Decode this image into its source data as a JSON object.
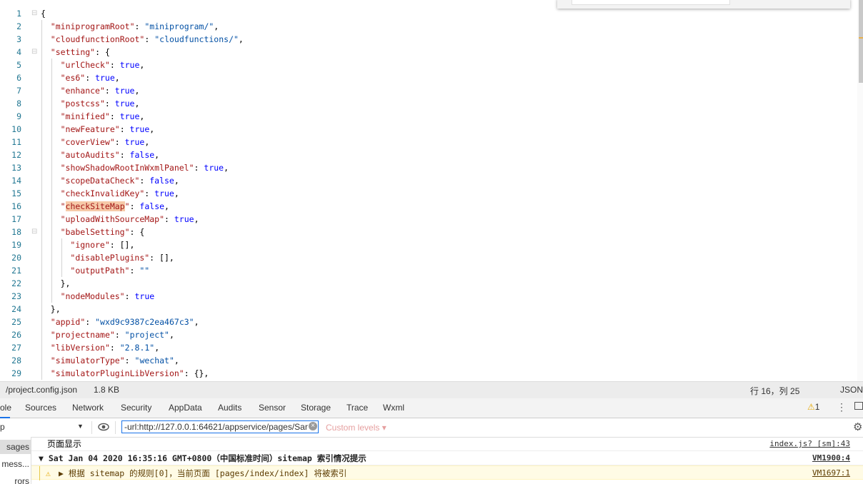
{
  "editor": {
    "lines": [
      [
        [
          "p",
          "{"
        ]
      ],
      [
        [
          "k",
          "\"miniprogramRoot\""
        ],
        [
          "p",
          ": "
        ],
        [
          "s",
          "\"miniprogram/\""
        ],
        [
          "p",
          ","
        ]
      ],
      [
        [
          "k",
          "\"cloudfunctionRoot\""
        ],
        [
          "p",
          ": "
        ],
        [
          "s",
          "\"cloudfunctions/\""
        ],
        [
          "p",
          ","
        ]
      ],
      [
        [
          "k",
          "\"setting\""
        ],
        [
          "p",
          ": {"
        ]
      ],
      [
        [
          "k",
          "\"urlCheck\""
        ],
        [
          "p",
          ": "
        ],
        [
          "b",
          "true"
        ],
        [
          "p",
          ","
        ]
      ],
      [
        [
          "k",
          "\"es6\""
        ],
        [
          "p",
          ": "
        ],
        [
          "b",
          "true"
        ],
        [
          "p",
          ","
        ]
      ],
      [
        [
          "k",
          "\"enhance\""
        ],
        [
          "p",
          ": "
        ],
        [
          "b",
          "true"
        ],
        [
          "p",
          ","
        ]
      ],
      [
        [
          "k",
          "\"postcss\""
        ],
        [
          "p",
          ": "
        ],
        [
          "b",
          "true"
        ],
        [
          "p",
          ","
        ]
      ],
      [
        [
          "k",
          "\"minified\""
        ],
        [
          "p",
          ": "
        ],
        [
          "b",
          "true"
        ],
        [
          "p",
          ","
        ]
      ],
      [
        [
          "k",
          "\"newFeature\""
        ],
        [
          "p",
          ": "
        ],
        [
          "b",
          "true"
        ],
        [
          "p",
          ","
        ]
      ],
      [
        [
          "k",
          "\"coverView\""
        ],
        [
          "p",
          ": "
        ],
        [
          "b",
          "true"
        ],
        [
          "p",
          ","
        ]
      ],
      [
        [
          "k",
          "\"autoAudits\""
        ],
        [
          "p",
          ": "
        ],
        [
          "b",
          "false"
        ],
        [
          "p",
          ","
        ]
      ],
      [
        [
          "k",
          "\"showShadowRootInWxmlPanel\""
        ],
        [
          "p",
          ": "
        ],
        [
          "b",
          "true"
        ],
        [
          "p",
          ","
        ]
      ],
      [
        [
          "k",
          "\"scopeDataCheck\""
        ],
        [
          "p",
          ": "
        ],
        [
          "b",
          "false"
        ],
        [
          "p",
          ","
        ]
      ],
      [
        [
          "k",
          "\"checkInvalidKey\""
        ],
        [
          "p",
          ": "
        ],
        [
          "b",
          "true"
        ],
        [
          "p",
          ","
        ]
      ],
      [
        [
          "k",
          "\""
        ],
        [
          "h",
          "checkSiteMap"
        ],
        [
          "k",
          "\""
        ],
        [
          "p",
          ": "
        ],
        [
          "b",
          "false"
        ],
        [
          "p",
          ","
        ]
      ],
      [
        [
          "k",
          "\"uploadWithSourceMap\""
        ],
        [
          "p",
          ": "
        ],
        [
          "b",
          "true"
        ],
        [
          "p",
          ","
        ]
      ],
      [
        [
          "k",
          "\"babelSetting\""
        ],
        [
          "p",
          ": {"
        ]
      ],
      [
        [
          "k",
          "\"ignore\""
        ],
        [
          "p",
          ": [],"
        ]
      ],
      [
        [
          "k",
          "\"disablePlugins\""
        ],
        [
          "p",
          ": [],"
        ]
      ],
      [
        [
          "k",
          "\"outputPath\""
        ],
        [
          "p",
          ": "
        ],
        [
          "s",
          "\"\""
        ]
      ],
      [
        [
          "p",
          "},"
        ]
      ],
      [
        [
          "k",
          "\"nodeModules\""
        ],
        [
          "p",
          ": "
        ],
        [
          "b",
          "true"
        ]
      ],
      [
        [
          "p",
          "},"
        ]
      ],
      [
        [
          "k",
          "\"appid\""
        ],
        [
          "p",
          ": "
        ],
        [
          "s",
          "\"wxd9c9387c2ea467c3\""
        ],
        [
          "p",
          ","
        ]
      ],
      [
        [
          "k",
          "\"projectname\""
        ],
        [
          "p",
          ": "
        ],
        [
          "s",
          "\"project\""
        ],
        [
          "p",
          ","
        ]
      ],
      [
        [
          "k",
          "\"libVersion\""
        ],
        [
          "p",
          ": "
        ],
        [
          "s",
          "\"2.8.1\""
        ],
        [
          "p",
          ","
        ]
      ],
      [
        [
          "k",
          "\"simulatorType\""
        ],
        [
          "p",
          ": "
        ],
        [
          "s",
          "\"wechat\""
        ],
        [
          "p",
          ","
        ]
      ],
      [
        [
          "k",
          "\"simulatorPluginLibVersion\""
        ],
        [
          "p",
          ": {},"
        ]
      ]
    ],
    "indents": [
      0,
      1,
      1,
      1,
      2,
      2,
      2,
      2,
      2,
      2,
      2,
      2,
      2,
      2,
      2,
      2,
      2,
      2,
      3,
      3,
      3,
      2,
      2,
      1,
      1,
      1,
      1,
      1,
      1
    ],
    "fold_lines": [
      1,
      4,
      18
    ]
  },
  "statusbar": {
    "file": "/project.config.json",
    "size": "1.8 KB",
    "cursor": "行 16，列 25",
    "language": "JSON"
  },
  "devtools": {
    "tabs": [
      "ole",
      "Sources",
      "Network",
      "Security",
      "AppData",
      "Audits",
      "Sensor",
      "Storage",
      "Trace",
      "Wxml"
    ],
    "warn_count": "1",
    "kebab": "⋮"
  },
  "console_toolbar": {
    "context": "p",
    "filter_value": "-url:http://127.0.0.1:64621/appservice/pages/Sar",
    "levels": "Custom levels"
  },
  "console_sidebar": [
    "sages",
    "mess...",
    "rors"
  ],
  "console_logs": [
    {
      "text": "页面显示",
      "source": "index.js? [sm]:43",
      "kind": "log"
    },
    {
      "text": "▼ Sat Jan 04 2020 16:35:16 GMT+0800（中国标准时间）sitemap 索引情况提示",
      "source": "VM1900:4",
      "kind": "group"
    },
    {
      "text": "▶ 根据 sitemap 的规则[0]，当前页面 [pages/index/index] 将被索引",
      "source": "VM1697:1",
      "kind": "warn"
    }
  ],
  "colors": {
    "accent": "#1a73e8",
    "warning": "#e6a800",
    "highlight": "#f6c9a8"
  }
}
